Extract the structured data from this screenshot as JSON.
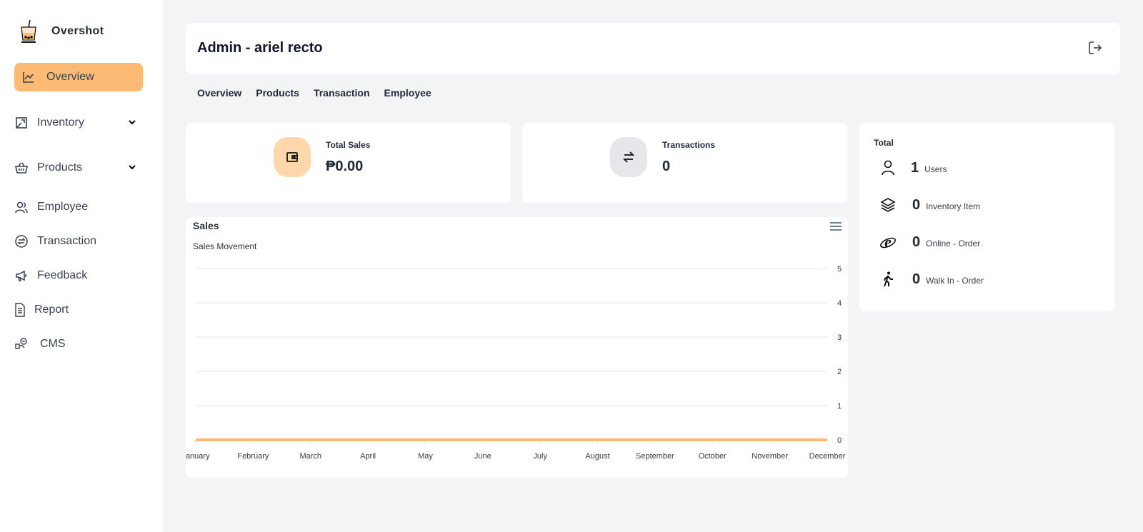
{
  "brand": {
    "name": "Overshot",
    "logo_icon": "boba-cup-logo-icon"
  },
  "sidebar": {
    "items": [
      {
        "label": "Overview",
        "icon": "line-chart-icon",
        "active": true
      },
      {
        "label": "Inventory",
        "icon": "inventory-icon",
        "expandable": true
      },
      {
        "label": "Products",
        "icon": "basket-icon",
        "expandable": true
      },
      {
        "label": "Employee",
        "icon": "users-icon"
      },
      {
        "label": "Transaction",
        "icon": "exchange-circle-icon"
      },
      {
        "label": "Feedback",
        "icon": "megaphone-icon"
      },
      {
        "label": "Report",
        "icon": "document-icon"
      },
      {
        "label": "CMS",
        "icon": "cms-icon"
      }
    ]
  },
  "header": {
    "title": "Admin - ariel recto",
    "logout_icon": "logout-icon"
  },
  "tabs": [
    "Overview",
    "Products",
    "Transaction",
    "Employee"
  ],
  "stats": {
    "total_sales": {
      "label": "Total Sales",
      "value": "₱0.00",
      "icon": "wallet-icon"
    },
    "transactions": {
      "label": "Transactions",
      "value": "0",
      "icon": "arrows-swap-icon"
    }
  },
  "totals": {
    "title": "Total",
    "rows": [
      {
        "value": "1",
        "label": "Users",
        "icon": "user-icon"
      },
      {
        "value": "0",
        "label": "Inventory Item",
        "icon": "layers-icon"
      },
      {
        "value": "0",
        "label": "Online - Order",
        "icon": "internet-explorer-icon"
      },
      {
        "value": "0",
        "label": "Walk In - Order",
        "icon": "walking-icon"
      }
    ]
  },
  "colors": {
    "accent": "#fdba74",
    "sales_circle": "#fed7aa",
    "transactions_circle": "#e5e7eb",
    "line": "#fdba74",
    "background": "#f3f4f6"
  },
  "chart_data": {
    "type": "line",
    "title": "Sales",
    "subtitle": "Sales Movement",
    "categories": [
      "January",
      "February",
      "March",
      "April",
      "May",
      "June",
      "July",
      "August",
      "September",
      "October",
      "November",
      "December"
    ],
    "series": [
      {
        "values": [
          0,
          0,
          0,
          0,
          0,
          0,
          0,
          0,
          0,
          0,
          0,
          0
        ]
      }
    ],
    "ylim": [
      0,
      5
    ],
    "yticks": [
      "0",
      "1",
      "2",
      "3",
      "4",
      "5"
    ],
    "y_axis_side": "right",
    "grid": true
  }
}
